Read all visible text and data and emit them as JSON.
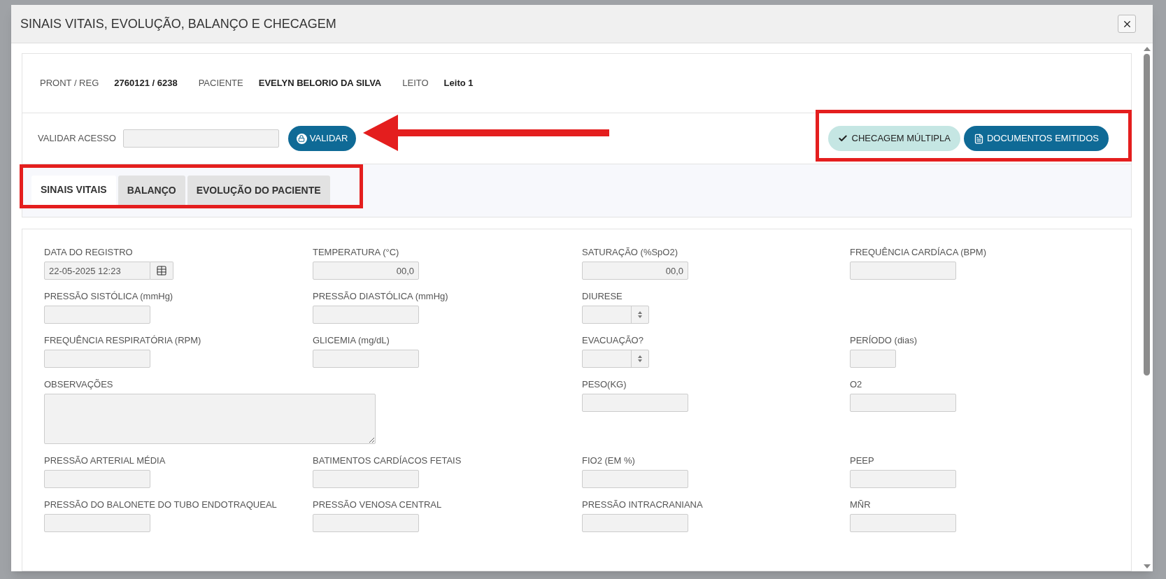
{
  "dialog": {
    "title": "SINAIS VITAIS, EVOLUÇÃO, BALANÇO E CHECAGEM"
  },
  "patient_info": [
    {
      "label": "PRONT / REG",
      "value": "2760121 / 6238"
    },
    {
      "label": "PACIENTE",
      "value": "EVELYN BELORIO DA SILVA"
    },
    {
      "label": "LEITO",
      "value": "Leito 1"
    }
  ],
  "access": {
    "label": "VALIDAR ACESSO",
    "button": "VALIDAR"
  },
  "actions": [
    {
      "label": "CHECAGEM MÚLTIPLA",
      "kind": "check"
    },
    {
      "label": "DOCUMENTOS EMITIDOS",
      "kind": "document"
    }
  ],
  "tabs": [
    {
      "label": "SINAIS VITAIS",
      "selected": true
    },
    {
      "label": "BALANÇO",
      "selected": false
    },
    {
      "label": "EVOLUÇÃO DO PACIENTE",
      "selected": false
    }
  ],
  "form_rows": [
    [
      {
        "label": "DATA DO REGISTRO",
        "kind": "date",
        "value": "22-05-2025 12:23"
      },
      {
        "label": "TEMPERATURA (°C)",
        "kind": "text",
        "value": "00,0"
      },
      {
        "label": "SATURAÇÃO (%SpO2)",
        "kind": "text",
        "value": "00,0"
      },
      {
        "label": "FREQUÊNCIA CARDÍACA (BPM)",
        "kind": "text"
      }
    ],
    [
      {
        "label": "PRESSÃO SISTÓLICA (mmHg)",
        "kind": "text"
      },
      {
        "label": "PRESSÃO DIASTÓLICA (mmHg)",
        "kind": "text"
      },
      {
        "label": "DIURESE",
        "kind": "select"
      }
    ],
    [
      {
        "label": "FREQUÊNCIA RESPIRATÓRIA (RPM)",
        "kind": "text"
      },
      {
        "label": "GLICEMIA (mg/dL)",
        "kind": "text"
      },
      {
        "label": "EVACUAÇÃO?",
        "kind": "select"
      },
      {
        "label": "PERÍODO (dias)",
        "kind": "short"
      }
    ],
    [
      {
        "label": "OBSERVAÇÕES",
        "kind": "textarea"
      },
      {
        "label": "PESO(KG)",
        "kind": "text"
      },
      {
        "label": "O2",
        "kind": "text"
      }
    ],
    [
      {
        "label": "PRESSÃO ARTERIAL MÉDIA",
        "kind": "text"
      },
      {
        "label": "BATIMENTOS CARDÍACOS FETAIS",
        "kind": "text"
      },
      {
        "label": "FIO2 (EM %)",
        "kind": "text"
      },
      {
        "label": "PEEP",
        "kind": "text"
      }
    ],
    [
      {
        "label": "PRESSÃO DO BALONETE DO TUBO ENDOTRAQUEAL",
        "kind": "text"
      },
      {
        "label": "PRESSÃO VENOSA CENTRAL",
        "kind": "text"
      },
      {
        "label": "PRESSÃO INTRACRANIANA",
        "kind": "text"
      },
      {
        "label": "MÑR",
        "kind": "text"
      }
    ]
  ]
}
